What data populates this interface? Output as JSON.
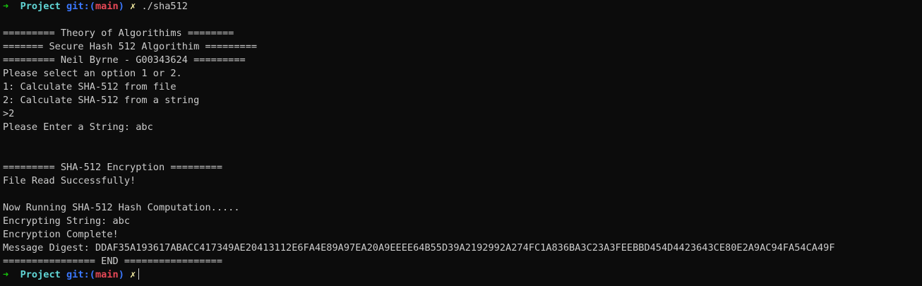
{
  "prompt": {
    "arrow": "➜",
    "dir": "Project",
    "git_prefix": "git:(",
    "branch": "main",
    "git_suffix": ")",
    "dirty_mark": "✗",
    "command": "./sha512"
  },
  "output": {
    "banner_1": "========= Theory of Algorithims ========",
    "banner_2": "======= Secure Hash 512 Algorithim =========",
    "banner_3": "========= Neil Byrne - G00343624 =========",
    "select_prompt": "Please select an option 1 or 2.",
    "option_1": "1: Calculate SHA-512 from file",
    "option_2": "2: Calculate SHA-512 from a string",
    "user_choice": ">2",
    "string_prompt": "Please Enter a String: abc",
    "encryption_banner": "========= SHA-512 Encryption =========",
    "file_read": "File Read Successfully!",
    "running": "Now Running SHA-512 Hash Computation.....",
    "encrypting": "Encrypting String: abc",
    "complete": "Encryption Complete!",
    "digest": "Message Digest: DDAF35A193617ABACC417349AE20413112E6FA4E89A97EA20A9EEEE64B55D39A2192992A274FC1A836BA3C23A3FEEBBD454D4423643CE80E2A9AC94FA54CA49F",
    "end_banner": "================ END ================="
  }
}
